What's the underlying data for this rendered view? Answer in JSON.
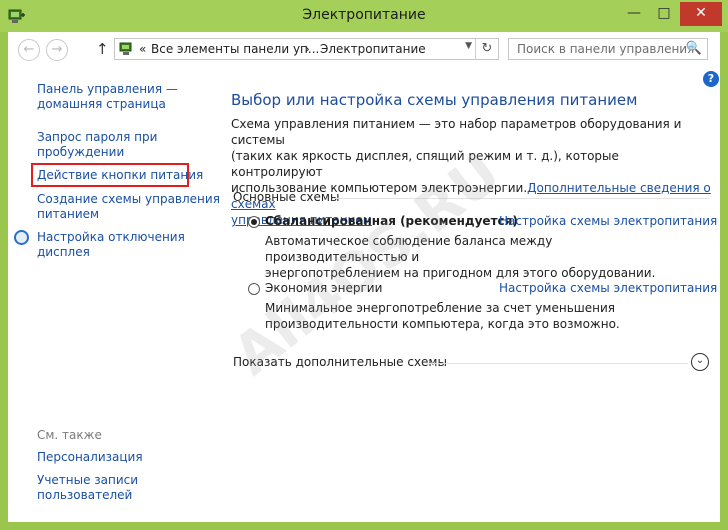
{
  "window": {
    "title": "Электропитание",
    "minimize_glyph": "—",
    "maximize_glyph": "□",
    "close_glyph": "✕"
  },
  "toolbar": {
    "back_glyph": "←",
    "forward_glyph": "→",
    "up_glyph": "↑",
    "refresh_glyph": "↻",
    "dropdown_glyph": "▼",
    "breadcrumb_sep": "«",
    "breadcrumb_arrow": "›",
    "breadcrumb_root": "Все элементы панели уп...",
    "breadcrumb_current": "Электропитание",
    "search_placeholder": "Поиск в панели управления",
    "search_glyph": "🔍"
  },
  "help_glyph": "?",
  "sidebar": {
    "items": [
      {
        "label_line1": "Панель управления —",
        "label_line2": "домашняя страница"
      },
      {
        "label_line1": "Запрос пароля при",
        "label_line2": "пробуждении"
      },
      {
        "label_line1": "Действие кнопки питания",
        "label_line2": ""
      },
      {
        "label_line1": "Создание схемы управления",
        "label_line2": "питанием"
      },
      {
        "label_line1": "Настройка отключения",
        "label_line2": "дисплея"
      }
    ],
    "see_also": "См. также",
    "see_also_items": [
      {
        "label_line1": "Персонализация",
        "label_line2": ""
      },
      {
        "label_line1": "Учетные записи",
        "label_line2": "пользователей"
      }
    ]
  },
  "main": {
    "heading": "Выбор или настройка схемы управления питанием",
    "desc_line1": "Схема управления питанием — это набор параметров оборудования и системы",
    "desc_line2": "(таких как яркость дисплея, спящий режим и т. д.), которые контролируют",
    "desc_line3_text": "использование компьютером электроэнергии.",
    "desc_link_part1": "Дополнительные сведения о схемах",
    "desc_link_part2": "управления питанием",
    "section_label": "Основные схемы",
    "plans": [
      {
        "name": "Сбалансированная (рекомендуется)",
        "link": "Настройка схемы электропитания",
        "desc_line1": "Автоматическое соблюдение баланса между производительностью и",
        "desc_line2": "энергопотреблением на пригодном для этого оборудовании.",
        "selected": true
      },
      {
        "name": "Экономия энергии",
        "link": "Настройка схемы электропитания",
        "desc_line1": "Минимальное энергопотребление за счет уменьшения",
        "desc_line2": "производительности компьютера, когда это возможно.",
        "selected": false
      }
    ],
    "show_more": "Показать дополнительные схемы",
    "expand_glyph": "⌄"
  },
  "watermark": "All4OS.RU",
  "colors": {
    "titlebar": "#a4cf58",
    "link": "#1a4fa3",
    "highlight_border": "#e21d1d",
    "close_button": "#c0392b"
  }
}
